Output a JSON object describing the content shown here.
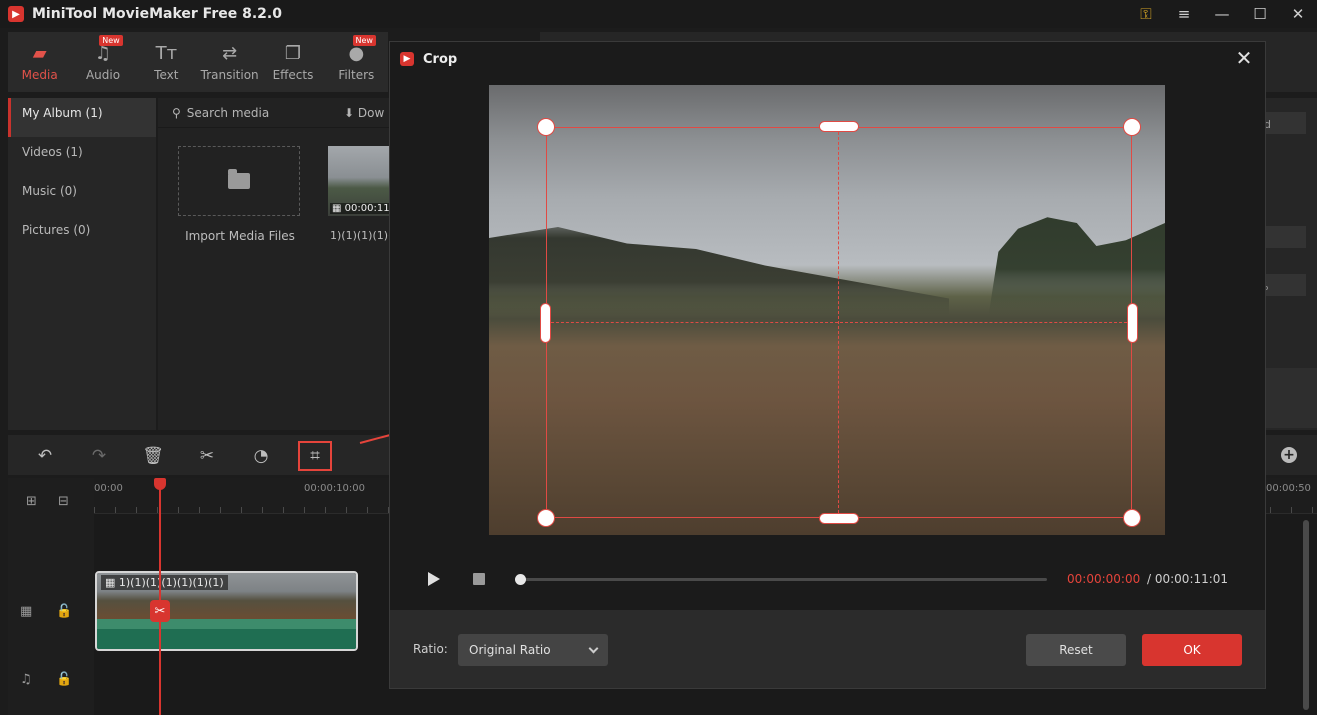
{
  "app": {
    "title": "MiniTool MovieMaker Free 8.2.0"
  },
  "toolbar": {
    "items": [
      {
        "label": "Media",
        "icon": "folder-icon",
        "active": true
      },
      {
        "label": "Audio",
        "icon": "music-note-icon",
        "badge": "New"
      },
      {
        "label": "Text",
        "icon": "text-icon"
      },
      {
        "label": "Transition",
        "icon": "transition-arrows-icon"
      },
      {
        "label": "Effects",
        "icon": "effects-icon"
      },
      {
        "label": "Filters",
        "icon": "filters-icon",
        "badge": "New"
      }
    ]
  },
  "sidebar": {
    "items": [
      {
        "label": "My Album (1)",
        "active": true
      },
      {
        "label": "Videos (1)"
      },
      {
        "label": "Music (0)"
      },
      {
        "label": "Pictures (0)"
      }
    ]
  },
  "media": {
    "search_placeholder": "Search media",
    "download_label": "Dow",
    "import_label": "Import Media Files",
    "clip_thumb_time": "00:00:11",
    "clip_thumb_label": "1)(1)(1)(1)("
  },
  "timeline": {
    "ruler_start": "00:00",
    "ruler_mid": "00:00:10:00",
    "ruler_end": "00:00:50",
    "clip_name": "1)(1)(1)(1)(1)(1)(1)"
  },
  "crop_dialog": {
    "title": "Crop",
    "current_time": "00:00:00:00",
    "total_time": "/ 00:00:11:01",
    "ratio_label": "Ratio:",
    "ratio_value": "Original Ratio",
    "reset_label": "Reset",
    "ok_label": "OK"
  },
  "background_panel": {
    "chip1": "d",
    "chip2": "%"
  },
  "colors": {
    "accent": "#d8352f",
    "highlight": "#e5443b"
  }
}
